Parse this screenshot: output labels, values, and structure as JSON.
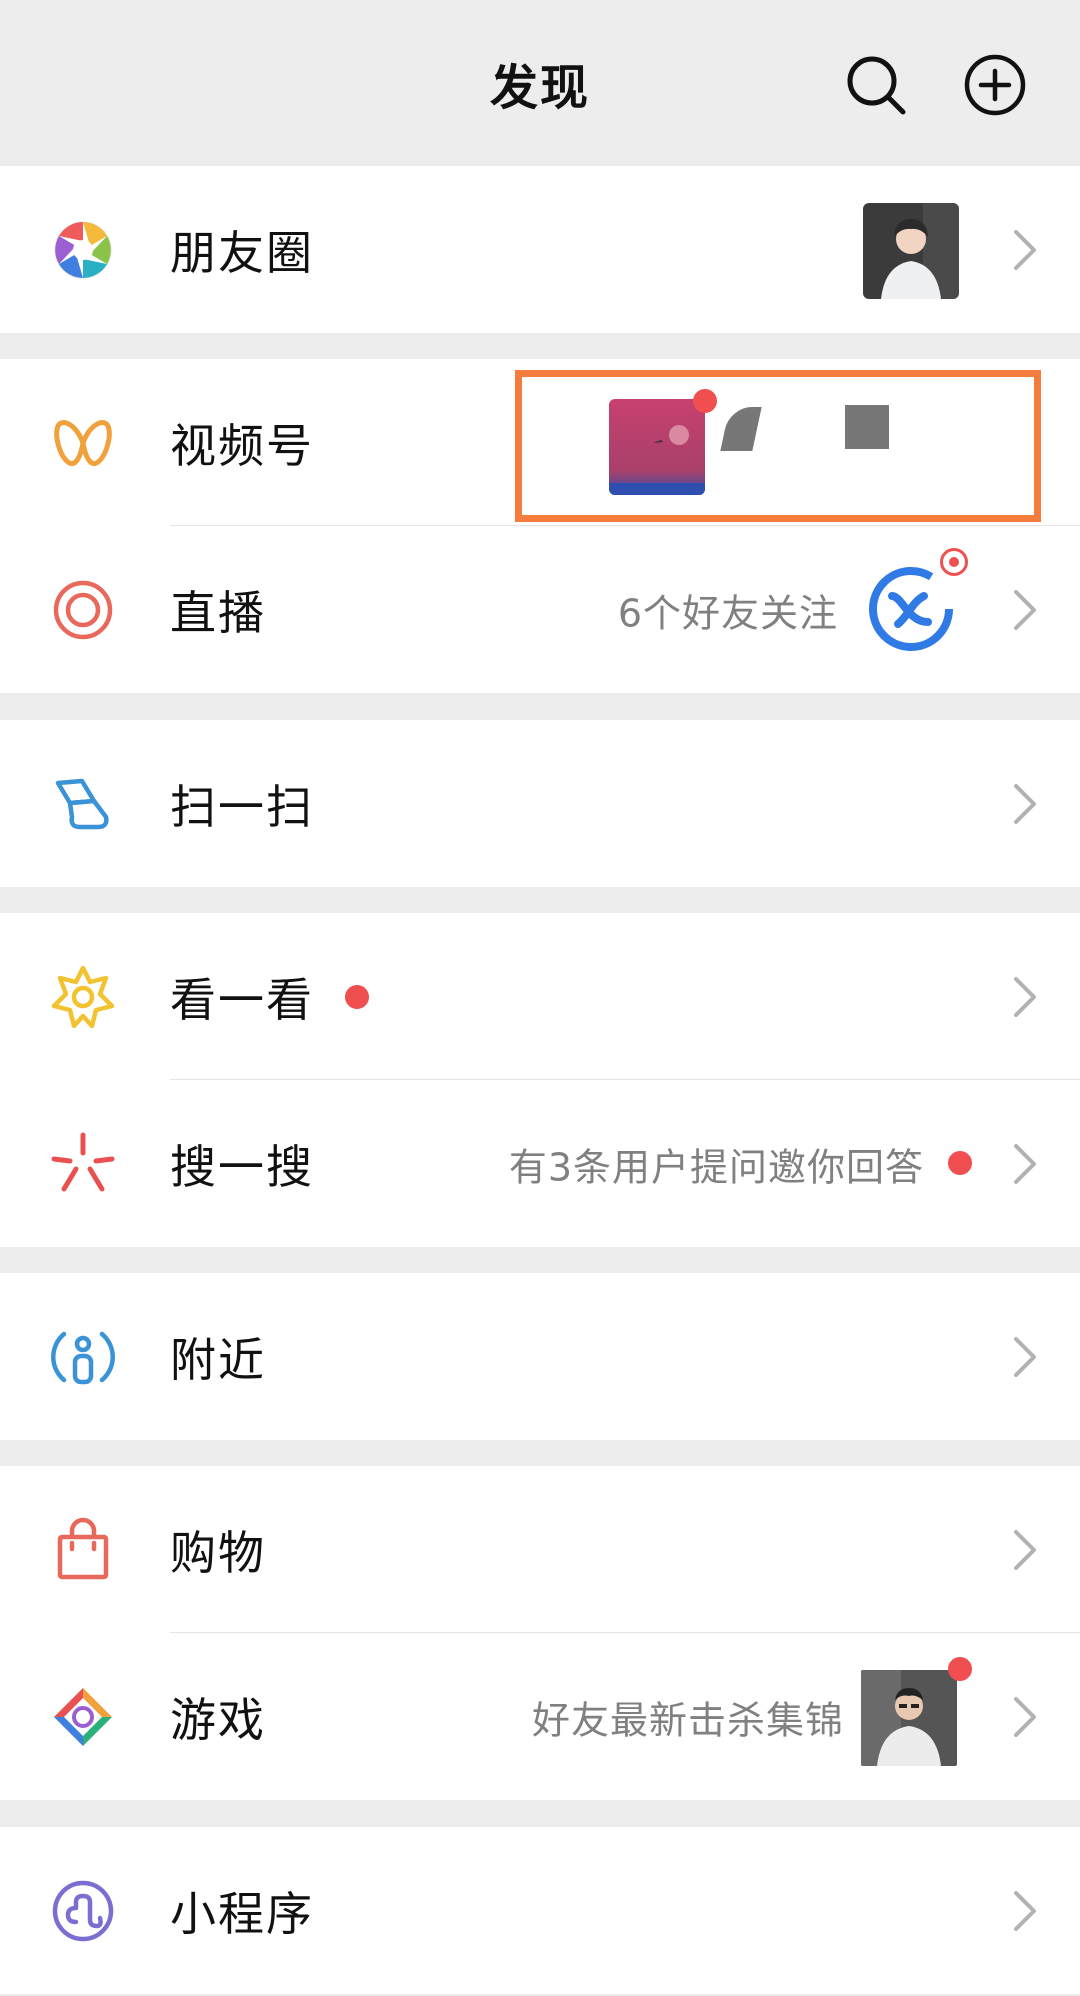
{
  "header": {
    "title": "发现"
  },
  "icons": {
    "header_search": "search-icon",
    "header_add": "add-circle-icon",
    "chevron": "chevron-right-icon"
  },
  "colors": {
    "background": "#ededed",
    "row_background": "#ffffff",
    "red_dot": "#f04f4f",
    "subtext": "#808080",
    "highlight_box": "#f47c3c"
  },
  "items": {
    "moments": {
      "label": "朋友圈",
      "icon": "moments-aperture-icon"
    },
    "channels": {
      "label": "视频号",
      "icon": "channels-butterfly-icon"
    },
    "live": {
      "label": "直播",
      "icon": "live-ring-icon",
      "subtext": "6个好友关注"
    },
    "scan": {
      "label": "扫一扫",
      "icon": "scan-icon"
    },
    "top_stories": {
      "label": "看一看",
      "icon": "top-stories-star-icon"
    },
    "search": {
      "label": "搜一搜",
      "icon": "search-sparkle-icon",
      "subtext": "有3条用户提问邀你回答"
    },
    "nearby": {
      "label": "附近",
      "icon": "nearby-person-icon"
    },
    "shopping": {
      "label": "购物",
      "icon": "shopping-bag-icon"
    },
    "games": {
      "label": "游戏",
      "icon": "games-diamond-icon",
      "subtext": "好友最新击杀集锦"
    },
    "mini_programs": {
      "label": "小程序",
      "icon": "mini-program-icon"
    }
  }
}
